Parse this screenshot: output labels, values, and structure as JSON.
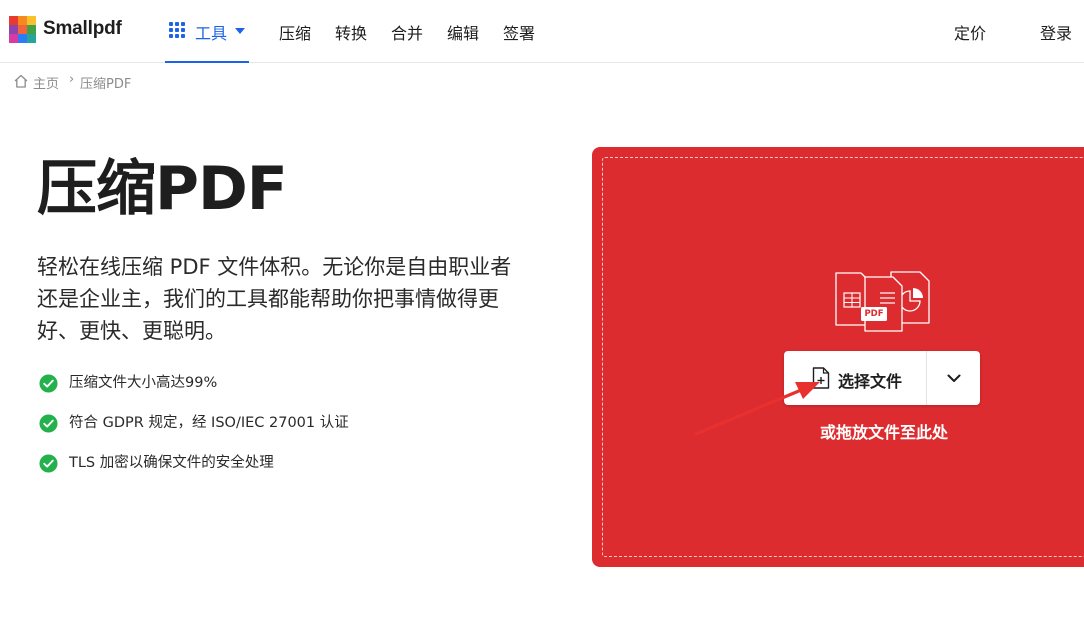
{
  "header": {
    "brand": "Smallpdf",
    "tools_label": "工具",
    "nav": [
      "压缩",
      "转换",
      "合并",
      "编辑",
      "签署"
    ],
    "pricing_label": "定价",
    "login_label": "登录"
  },
  "breadcrumb": {
    "home": "主页",
    "separator": "›",
    "current": "压缩PDF"
  },
  "hero": {
    "title": "压缩PDF",
    "description": "轻松在线压缩 PDF 文件体积。无论你是自由职业者还是企业主，我们的工具都能帮助你把事情做得更好、更快、更聪明。",
    "features": [
      "压缩文件大小高达99%",
      "符合 GDPR 规定，经 ISO/IEC 27001 认证",
      "TLS 加密以确保文件的安全处理"
    ]
  },
  "upload": {
    "choose_label": "选择文件",
    "drop_hint": "或拖放文件至此处",
    "illustration_badge": "PDF"
  },
  "colors": {
    "accent": "#1d63e8",
    "dropzone": "#dd2c2f",
    "check": "#22b14c",
    "annotation_arrow": "#e8302e"
  },
  "icons": {
    "logo": "smallpdf-logo-icon",
    "tools": "grid-icon",
    "home": "home-icon",
    "check": "check-circle-icon",
    "choose": "file-plus-icon",
    "dropdown": "chevron-down-icon"
  }
}
